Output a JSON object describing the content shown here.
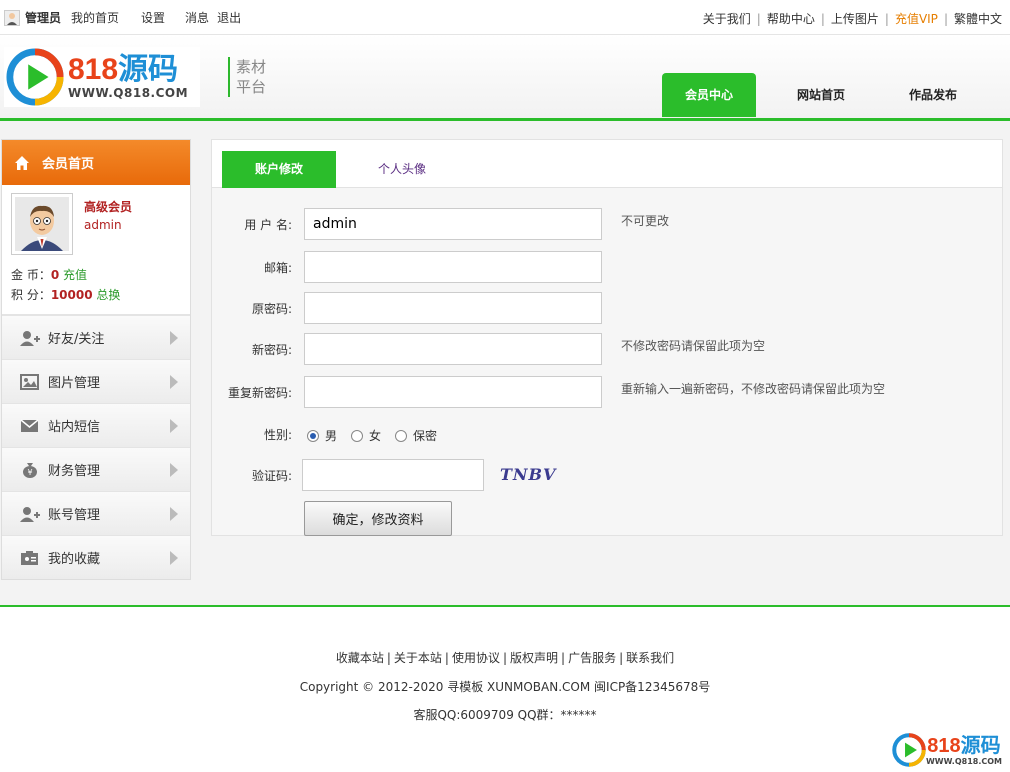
{
  "topbar": {
    "user": "管理员",
    "links_left": [
      "我的首页",
      "设置",
      "消息",
      "退出"
    ],
    "links_right": [
      "关于我们",
      "帮助中心",
      "上传图片",
      "充值VIP",
      "繁體中文"
    ]
  },
  "header": {
    "logo_number": "818",
    "logo_cn": "源码",
    "logo_url": "WWW.Q818.COM",
    "subtitle_line1": "素材",
    "subtitle_line2": "平台",
    "nav": [
      "会员中心",
      "网站首页",
      "作品发布"
    ],
    "active_nav": "会员中心"
  },
  "sidebar": {
    "title": "会员首页",
    "profile": {
      "level": "高级会员",
      "username": "admin",
      "coins_label": "金 币：",
      "coins_value": "0",
      "coins_action": "充值",
      "points_label": "积 分：",
      "points_value": "10000",
      "points_action": "总换"
    },
    "items": [
      {
        "label": "好友/关注",
        "icon": "friend-add-icon"
      },
      {
        "label": "图片管理",
        "icon": "image-icon"
      },
      {
        "label": "站内短信",
        "icon": "mail-icon"
      },
      {
        "label": "财务管理",
        "icon": "money-bag-icon"
      },
      {
        "label": "账号管理",
        "icon": "account-icon"
      },
      {
        "label": "我的收藏",
        "icon": "favorite-icon"
      }
    ]
  },
  "panel": {
    "tabs": [
      "账户修改",
      "个人头像"
    ],
    "form": {
      "username_label": "用 户 名:",
      "username_value": "admin",
      "username_hint": "不可更改",
      "email_label": "邮箱:",
      "email_value": "",
      "old_password_label": "原密码:",
      "new_password_label": "新密码:",
      "new_password_hint": "不修改密码请保留此项为空",
      "repeat_password_label": "重复新密码:",
      "repeat_password_hint": "重新输入一遍新密码，不修改密码请保留此项为空",
      "gender_label": "性别:",
      "gender_options": [
        "男",
        "女",
        "保密"
      ],
      "gender_selected": "男",
      "captcha_label": "验证码:",
      "captcha_text": "TNBV",
      "submit_label": "确定，修改资料"
    }
  },
  "footer": {
    "links": [
      "收藏本站",
      "关于本站",
      "使用协议",
      "版权声明",
      "广告服务",
      "联系我们"
    ],
    "copyright": "Copyright © 2012-2020 寻模板 XUNMOBAN.COM 闽ICP备12345678号",
    "qq": "客服QQ:6009709 QQ群：******",
    "logo_number": "818",
    "logo_cn": "源码",
    "logo_url": "WWW.Q818.COM"
  },
  "colors": {
    "accent_green": "#2bbd2b",
    "accent_orange": "#f07c1a",
    "vip_orange": "#e67e00",
    "value_red": "#b22222"
  }
}
